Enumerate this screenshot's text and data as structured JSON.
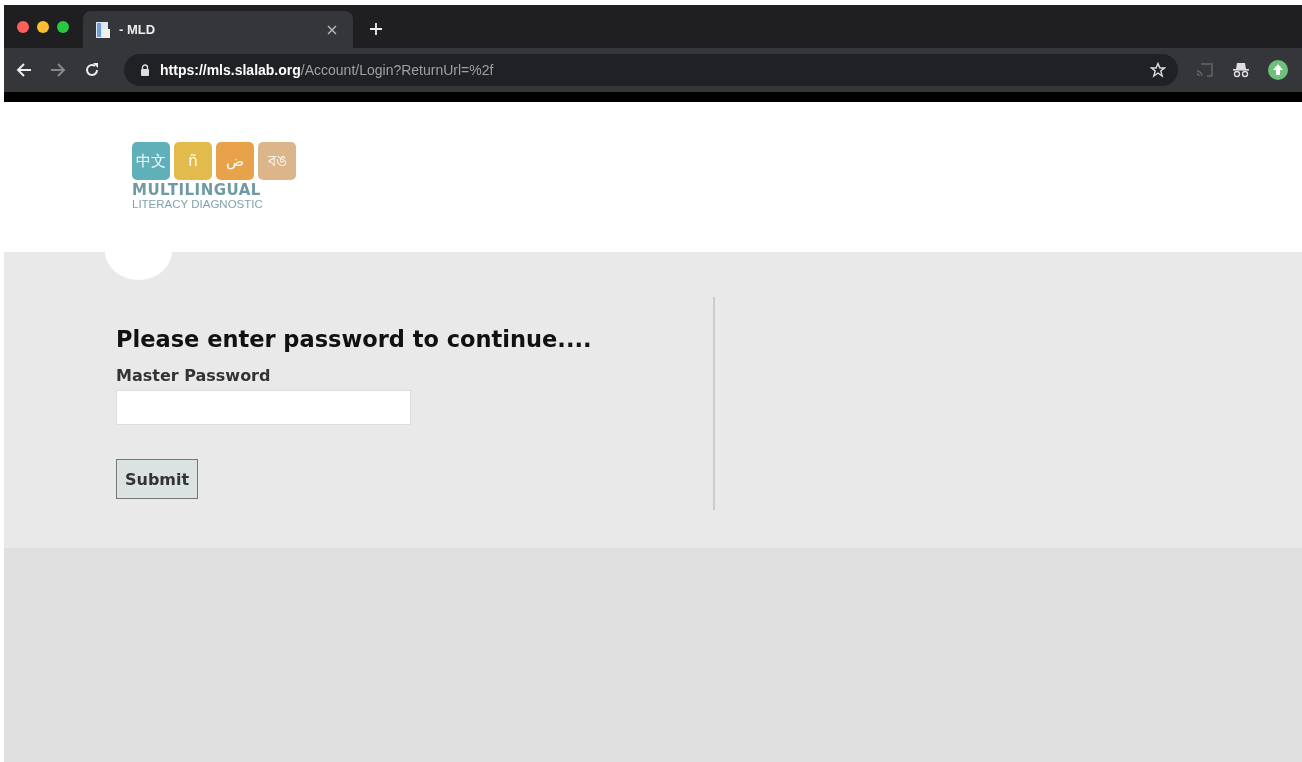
{
  "browser": {
    "tab": {
      "title": "- MLD",
      "selected": true
    },
    "url_host": "https://mls.slalab.org",
    "url_path": "/Account/Login?ReturnUrl=%2f"
  },
  "logo": {
    "tiles": [
      {
        "text": "中文",
        "color": "#5fb0b8"
      },
      {
        "text": "ñ",
        "color": "#e2bb4c"
      },
      {
        "text": "ض",
        "color": "#e8a24a"
      },
      {
        "text": "বঙ",
        "color": "#ddb58a"
      }
    ],
    "title": "MULTILINGUAL",
    "subtitle": "LITERACY DIAGNOSTIC"
  },
  "form": {
    "heading": "Please enter password to continue....",
    "label": "Master Password",
    "button": "Submit"
  }
}
